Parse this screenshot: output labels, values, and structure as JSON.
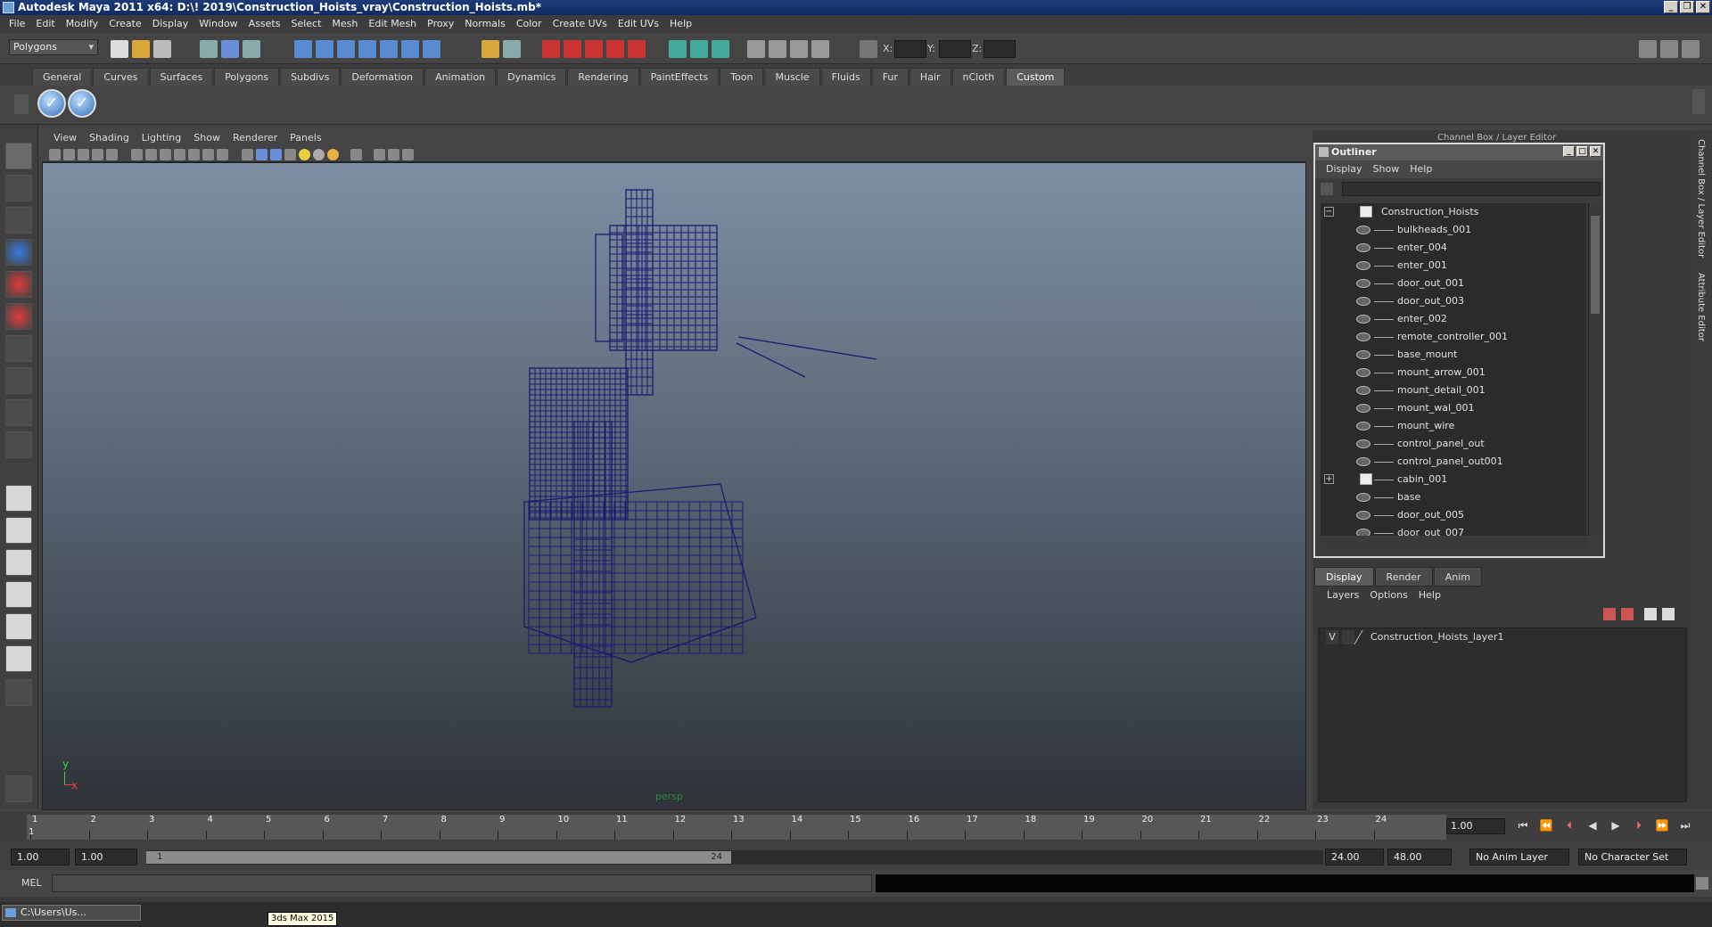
{
  "window": {
    "title": "Autodesk Maya 2011 x64: D:\\! 2019\\Construction_Hoists_vray\\Construction_Hoists.mb*"
  },
  "menubar": [
    "File",
    "Edit",
    "Modify",
    "Create",
    "Display",
    "Window",
    "Assets",
    "Select",
    "Mesh",
    "Edit Mesh",
    "Proxy",
    "Normals",
    "Color",
    "Create UVs",
    "Edit UVs",
    "Help"
  ],
  "statusline": {
    "mode": "Polygons",
    "x_label": "X:",
    "y_label": "Y:",
    "z_label": "Z:"
  },
  "shelf_tabs": [
    "General",
    "Curves",
    "Surfaces",
    "Polygons",
    "Subdivs",
    "Deformation",
    "Animation",
    "Dynamics",
    "Rendering",
    "PaintEffects",
    "Toon",
    "Muscle",
    "Fluids",
    "Fur",
    "Hair",
    "nCloth",
    "Custom"
  ],
  "shelf_active": "Custom",
  "viewport": {
    "menu": [
      "View",
      "Shading",
      "Lighting",
      "Show",
      "Renderer",
      "Panels"
    ],
    "camera_label": "persp",
    "axis_x": "x",
    "axis_y": "y",
    "wire_color": "#1a1a6e"
  },
  "outliner": {
    "title": "Outliner",
    "menu": [
      "Display",
      "Show",
      "Help"
    ],
    "root": "Construction_Hoists",
    "items": [
      "bulkheads_001",
      "enter_004",
      "enter_001",
      "door_out_001",
      "door_out_003",
      "enter_002",
      "remote_controller_001",
      "base_mount",
      "mount_arrow_001",
      "mount_detail_001",
      "mount_wal_001",
      "mount_wire",
      "control_panel_out",
      "control_panel_out001",
      "cabin_001",
      "base",
      "door_out_005",
      "door_out_007"
    ]
  },
  "right_panel": {
    "header": "Channel Box / Layer Editor"
  },
  "layers": {
    "tabs": [
      "Display",
      "Render",
      "Anim"
    ],
    "menu": [
      "Layers",
      "Options",
      "Help"
    ],
    "rows": [
      {
        "visible": "V",
        "name": "Construction_Hoists_layer1"
      }
    ]
  },
  "side_tabs": [
    "Channel Box / Layer Editor",
    "Attribute Editor"
  ],
  "timeline": {
    "ticks": [
      "1",
      "2",
      "3",
      "4",
      "5",
      "6",
      "7",
      "8",
      "9",
      "10",
      "11",
      "12",
      "13",
      "14",
      "15",
      "16",
      "17",
      "18",
      "19",
      "20",
      "21",
      "22",
      "23",
      "24"
    ],
    "current_marker": "1",
    "current_frame": "1.00"
  },
  "range": {
    "start": "1.00",
    "playback_start": "1.00",
    "slider_start": "1",
    "slider_end": "24",
    "playback_end": "24.00",
    "end": "48.00",
    "anim_layer": "No Anim Layer",
    "char_set": "No Character Set"
  },
  "cmdline": {
    "label": "MEL"
  },
  "taskbar": {
    "window": "C:\\Users\\Us...",
    "tooltip": "3ds Max 2015"
  }
}
